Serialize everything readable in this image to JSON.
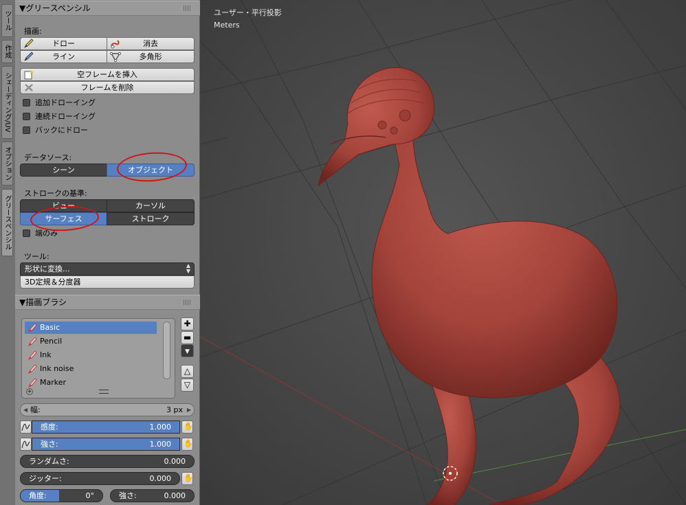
{
  "tabs": [
    {
      "label": "ツール",
      "active": false
    },
    {
      "label": "作成",
      "active": false
    },
    {
      "label": "シェーディング/UV",
      "active": false
    },
    {
      "label": "オプション",
      "active": false
    },
    {
      "label": "グリースペンシル",
      "active": true
    }
  ],
  "grease_pencil": {
    "title": "▼グリースペンシル",
    "draw_label": "描画:",
    "buttons": {
      "draw": "ドロー",
      "erase": "消去",
      "line": "ライン",
      "poly": "多角形",
      "insert_blank_frame": "空フレームを挿入",
      "delete_frame": "フレームを削除"
    },
    "checkboxes": {
      "additive_drawing": "追加ドローイング",
      "continuous_drawing": "連続ドローイング",
      "draw_on_back": "バックにドロー"
    },
    "data_source": {
      "label": "データソース:",
      "options": [
        "シーン",
        "オブジェクト"
      ],
      "selected": "オブジェクト"
    },
    "stroke_placement": {
      "label": "ストロークの基準:",
      "options": [
        "ビュー",
        "カーソル",
        "サーフェス",
        "ストローク"
      ],
      "selected": "サーフェス"
    },
    "only_endpoints": "端のみ",
    "tools": {
      "label": "ツール:",
      "convert": "形状に変換...",
      "ruler": "3D定規＆分度器"
    }
  },
  "draw_brush": {
    "title": "▼描画ブラシ",
    "brushes": [
      "Basic",
      "Pencil",
      "Ink",
      "Ink noise",
      "Marker"
    ],
    "selected": "Basic",
    "thickness": {
      "label": "幅:",
      "value": "3 px"
    },
    "sensitivity": {
      "label": "感度:",
      "value": "1.000",
      "fraction": 1.0
    },
    "strength": {
      "label": "強さ:",
      "value": "1.000",
      "fraction": 1.0
    },
    "randomness": {
      "label": "ランダムさ:",
      "value": "0.000",
      "fraction": 0.0
    },
    "jitter": {
      "label": "ジッター:",
      "value": "0.000",
      "fraction": 0.0
    },
    "angle": {
      "label": "角度:",
      "value": "0°"
    },
    "angle_strength": {
      "label": "強さ:",
      "value": "0.000"
    }
  },
  "viewport": {
    "view_name": "ユーザー・平行投影",
    "units": "Meters"
  },
  "colors": {
    "accent": "#5680c2",
    "annotation": "#d0141a",
    "model": "#a8453d"
  }
}
